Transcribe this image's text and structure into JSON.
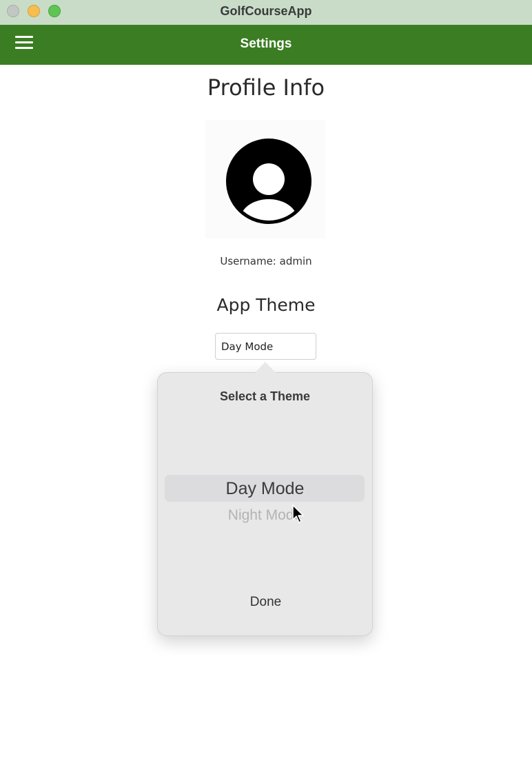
{
  "window": {
    "title": "GolfCourseApp"
  },
  "header": {
    "title": "Settings",
    "menu_icon": "hamburger-menu-icon",
    "background_color": "#3a7d22"
  },
  "profile": {
    "title": "Profile Info",
    "avatar_icon": "user-avatar-icon",
    "username_text": "Username: admin"
  },
  "theme": {
    "title": "App Theme",
    "selected_value": "Day Mode"
  },
  "theme_picker": {
    "title": "Select a Theme",
    "options": [
      "Day Mode",
      "Night Mode"
    ],
    "selected_index": 0,
    "done_label": "Done"
  }
}
